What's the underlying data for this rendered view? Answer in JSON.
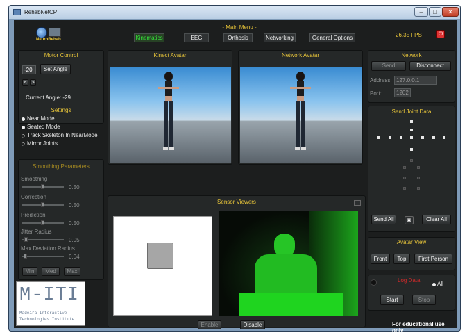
{
  "window": {
    "title": "RehabNetCP",
    "minimize": "–",
    "maximize": "□",
    "close": "✕"
  },
  "header": {
    "logo_text": "NeuroRehab",
    "menu_title": "- Main Menu -",
    "tabs": [
      {
        "label": "Kinematics",
        "active": true
      },
      {
        "label": "EEG",
        "active": false
      },
      {
        "label": "Orthosis",
        "active": false
      },
      {
        "label": "Networking",
        "active": false
      },
      {
        "label": "General Options",
        "active": false
      }
    ],
    "fps": "26.35 FPS"
  },
  "motor_control": {
    "title": "Motor Control",
    "angle_value": "-20",
    "set_angle_label": "Set Angle",
    "left_arrow": "<",
    "right_arrow": ">",
    "current_angle": "Current Angle: -29"
  },
  "settings": {
    "title": "Settings",
    "options": [
      {
        "label": "Near Mode",
        "checked": true
      },
      {
        "label": "Seated Mode",
        "checked": true
      },
      {
        "label": "Track Skeleton In NearMode",
        "checked": false
      },
      {
        "label": "Mirror Joints",
        "checked": false
      }
    ]
  },
  "smoothing": {
    "title": "Smoothing Parameters",
    "params": [
      {
        "label": "Smoothing",
        "value": "0.50",
        "level": 0.5
      },
      {
        "label": "Correction",
        "value": "0.50",
        "level": 0.5
      },
      {
        "label": "Prediction",
        "value": "0.50",
        "level": 0.5
      },
      {
        "label": "Jitter Radius",
        "value": "0.05",
        "level": 0.1
      },
      {
        "label": "Max Deviation Radius",
        "value": "0.04",
        "level": 0.08
      }
    ],
    "presets": [
      "Min",
      "Med",
      "Max"
    ]
  },
  "logo": {
    "mark": "M-ITI",
    "line1": "Madeira Interactive",
    "line2": "Technologies Institute"
  },
  "kinect_avatar": {
    "title": "Kinect Avatar"
  },
  "network_avatar": {
    "title": "Network Avatar"
  },
  "sensor_viewers": {
    "title": "Sensor Viewers",
    "enable_label": "Enable",
    "disable_label": "Disable"
  },
  "network": {
    "title": "Network",
    "send_label": "Send",
    "disconnect_label": "Disconnect",
    "address_label": "Address:",
    "address_value": "127.0.0.1",
    "port_label": "Port:",
    "port_value": "1202"
  },
  "send_joint_data": {
    "title": "Send Joint Data",
    "send_all": "Send All",
    "clear_all": "Clear All"
  },
  "avatar_view": {
    "title": "Avatar View",
    "options": [
      "Front",
      "Top",
      "First Person"
    ]
  },
  "log_data": {
    "title": "Log Data",
    "all_label": "All",
    "start_label": "Start",
    "stop_label": "Stop"
  },
  "footer": {
    "note": "For educational use only"
  },
  "colors": {
    "accent": "#e9c63a",
    "active_tab": "#36e33a",
    "log_title": "#d42a2a",
    "depth_green": "#2bd62b"
  }
}
